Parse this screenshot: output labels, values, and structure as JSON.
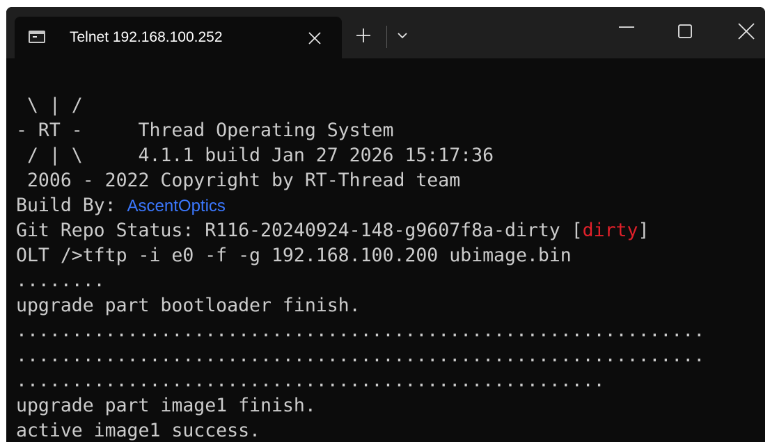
{
  "titlebar": {
    "tab_title": "Telnet 192.168.100.252"
  },
  "icons": {
    "tab": "terminal-icon",
    "tab_close": "close-icon",
    "new_tab": "plus-icon",
    "dropdown": "chevron-down-icon",
    "minimize": "minimize-icon",
    "maximize": "maximize-icon",
    "window_close": "close-icon"
  },
  "colors": {
    "background": "#0c0c0c",
    "titlebar": "#1f1f1f",
    "text": "#cccccc",
    "blue": "#3b78ff",
    "red": "#e0202a"
  },
  "terminal": {
    "logo_1": " \\ | /",
    "logo_2": "- RT -     Thread Operating System",
    "logo_3": " / | \\     4.1.1 build Jan 27 2026 15:17:36",
    "copyright": " 2006 - 2022 Copyright by RT-Thread team",
    "build_by_label": "Build By: ",
    "build_by_value": "AscentOptics",
    "git_status_label": "Git Repo Status: R116-20240924-148-g9607f8a-dirty [",
    "git_status_tag": "dirty",
    "git_status_close": "]",
    "command": "OLT />tftp -i e0 -f -g 192.168.100.200 ubimage.bin",
    "progress_1": "........",
    "bootloader_finish": "upgrade part bootloader finish.",
    "progress_2": "..............................................................",
    "progress_3": "..............................................................",
    "progress_4": ".....................................................",
    "image1_finish": "upgrade part image1 finish.",
    "active_success": "active image1 success."
  }
}
